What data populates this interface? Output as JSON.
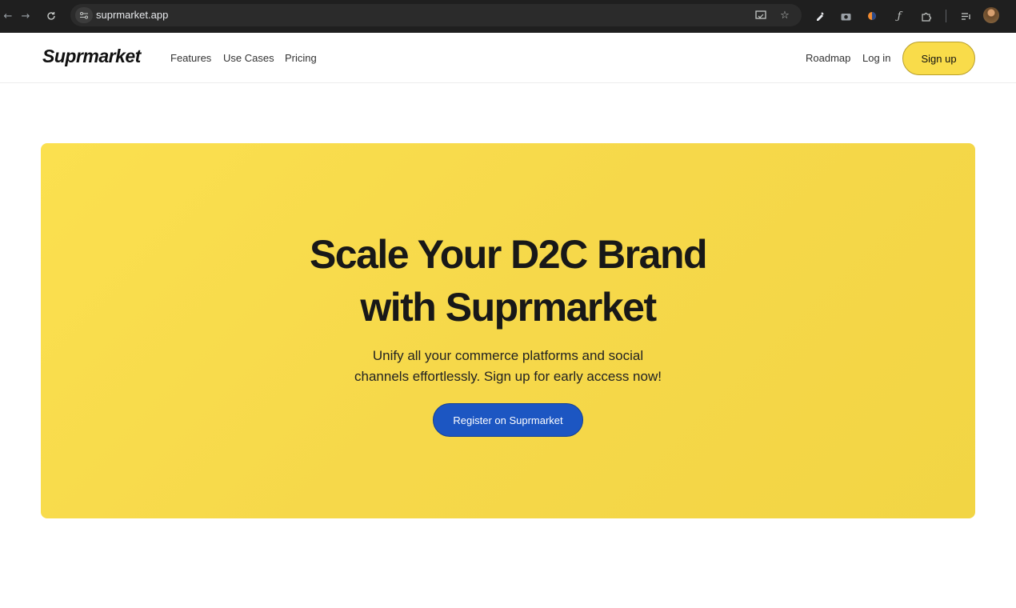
{
  "browser": {
    "url": "suprmarket.app",
    "icons": {
      "back": "back-arrow-icon",
      "forward": "forward-arrow-icon",
      "reload": "reload-icon",
      "site_info": "site-settings-icon",
      "cast": "cast-icon",
      "bookmark": "star-icon",
      "extensions": [
        "eyedropper-icon",
        "camera-icon",
        "half-moon-icon",
        "font-icon",
        "puzzle-icon",
        "reading-list-icon"
      ],
      "profile": "avatar"
    }
  },
  "header": {
    "logo": "Suprmarket",
    "nav_left": [
      "Features",
      "Use Cases",
      "Pricing"
    ],
    "nav_right": {
      "roadmap": "Roadmap",
      "login": "Log in",
      "signup": "Sign up"
    }
  },
  "hero": {
    "title_line1": "Scale Your D2C Brand",
    "title_line2": "with Suprmarket",
    "subtitle_line1": "Unify all your commerce platforms and social",
    "subtitle_line2": "channels effortlessly. Sign up for early access now!",
    "cta": "Register on Suprmarket"
  },
  "colors": {
    "accent_yellow": "#f9dc4a",
    "cta_blue": "#1c56c2",
    "chrome_bg": "#1f1f1f"
  }
}
